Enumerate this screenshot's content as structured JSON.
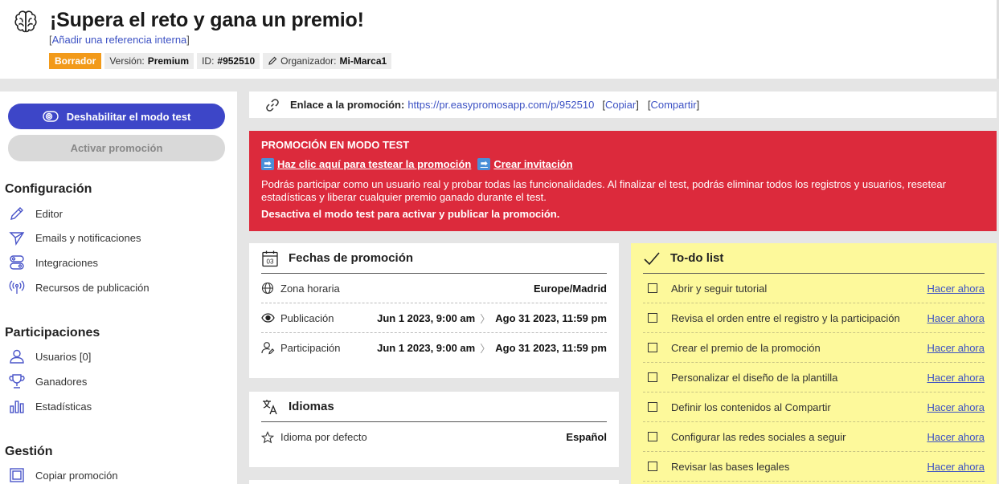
{
  "header": {
    "title": "¡Supera el reto y gana un premio!",
    "ref_open": "[",
    "ref_link": "Añadir una referencia interna",
    "ref_close": "]",
    "draft_badge": "Borrador",
    "version_label": "Versión:",
    "version_value": "Premium",
    "id_label": "ID:",
    "id_value": "#952510",
    "organizer_label": "Organizador:",
    "organizer_value": "Mi-Marca1"
  },
  "sidebar": {
    "disable_test_label": "Deshabilitar el modo test",
    "activate_label": "Activar promoción",
    "sections": [
      {
        "title": "Configuración",
        "items": [
          {
            "label": "Editor",
            "icon": "pencil-icon"
          },
          {
            "label": "Emails y notificaciones",
            "icon": "send-icon"
          },
          {
            "label": "Integraciones",
            "icon": "toggles-icon"
          },
          {
            "label": "Recursos de publicación",
            "icon": "broadcast-icon"
          }
        ]
      },
      {
        "title": "Participaciones",
        "items": [
          {
            "label": "Usuarios [0]",
            "icon": "user-icon"
          },
          {
            "label": "Ganadores",
            "icon": "trophy-icon"
          },
          {
            "label": "Estadísticas",
            "icon": "bar-chart-icon"
          }
        ]
      },
      {
        "title": "Gestión",
        "items": [
          {
            "label": "Copiar promoción",
            "icon": "copy-icon"
          }
        ]
      }
    ]
  },
  "linkbar": {
    "label": "Enlace a la promoción:",
    "url": "https://pr.easypromosapp.com/p/952510",
    "copy": "Copiar",
    "share": "Compartir"
  },
  "testmode": {
    "title": "PROMOCIÓN EN MODO TEST",
    "link1": "Haz clic aquí para testear la promoción",
    "link2": "Crear invitación",
    "description": "Podrás participar como un usuario real y probar todas las funcionalidades. Al finalizar el test, podrás eliminar todos los registros y usuarios, resetear estadísticas y liberar cualquier premio ganado durante el test.",
    "warning": "Desactiva el modo test para activar y publicar la promoción.",
    "bg_color": "#dc2a3c"
  },
  "dates": {
    "title": "Fechas de promoción",
    "calendar_day": "03",
    "timezone_label": "Zona horaria",
    "timezone_value": "Europe/Madrid",
    "publication_label": "Publicación",
    "publication_start": "Jun 1 2023, 9:00 am",
    "publication_end": "Ago 31 2023, 11:59 pm",
    "participation_label": "Participación",
    "participation_start": "Jun 1 2023, 9:00 am",
    "participation_end": "Ago 31 2023, 11:59 pm"
  },
  "languages": {
    "title": "Idiomas",
    "default_label": "Idioma por defecto",
    "default_value": "Español"
  },
  "todo": {
    "title": "To-do list",
    "action_label": "Hacer ahora",
    "items": [
      "Abrir y seguir tutorial",
      "Revisa el orden entre el registro y la participación",
      "Crear el premio de la promoción",
      "Personalizar el diseño de la plantilla",
      "Definir los contenidos al Compartir",
      "Configurar las redes sociales a seguir",
      "Revisar las bases legales"
    ],
    "bg_color": "#fdf99b"
  },
  "colors": {
    "accent": "#3d46c8",
    "link": "#3d52c4",
    "draft": "#f29a1a"
  }
}
